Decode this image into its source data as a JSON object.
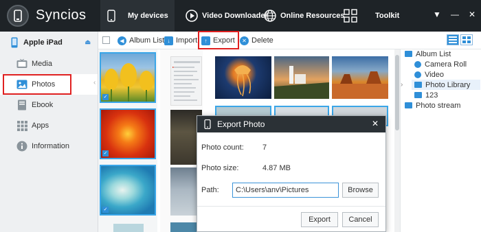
{
  "app": {
    "title": "Syncios"
  },
  "nav": {
    "tabs": [
      {
        "label": "My devices",
        "icon": "phone-icon"
      },
      {
        "label": "Video Downloader",
        "icon": "play-circle-icon"
      },
      {
        "label": "Online Resources",
        "icon": "globe-icon"
      },
      {
        "label": "Toolkit",
        "icon": "grid-icon"
      }
    ],
    "window_controls": [
      "▼",
      "—",
      "✕"
    ]
  },
  "sidebar": {
    "device_name": "Apple iPad",
    "items": [
      {
        "label": "Media",
        "icon": "tv-icon"
      },
      {
        "label": "Photos",
        "icon": "photo-icon"
      },
      {
        "label": "Ebook",
        "icon": "book-icon"
      },
      {
        "label": "Apps",
        "icon": "apps-icon"
      },
      {
        "label": "Information",
        "icon": "info-icon"
      }
    ],
    "active": "Photos"
  },
  "toolbar": {
    "album_list": "Album List",
    "import": "Import",
    "export": "Export",
    "delete": "Delete"
  },
  "tree": {
    "root": "Album List",
    "items": [
      "Camera Roll",
      "Video",
      "Photo Library",
      "123"
    ],
    "selected": "Photo Library",
    "photo_stream": "Photo stream"
  },
  "dialog": {
    "title": "Export Photo",
    "photo_count_label": "Photo count:",
    "photo_count_value": "7",
    "photo_size_label": "Photo size:",
    "photo_size_value": "4.87 MB",
    "path_label": "Path:",
    "path_value": "C:\\Users\\anv\\Pictures",
    "browse": "Browse",
    "export": "Export",
    "cancel": "Cancel",
    "close": "✕"
  },
  "colors": {
    "accent": "#2f8fd8",
    "highlight": "#e02020",
    "header": "#1e2327"
  }
}
